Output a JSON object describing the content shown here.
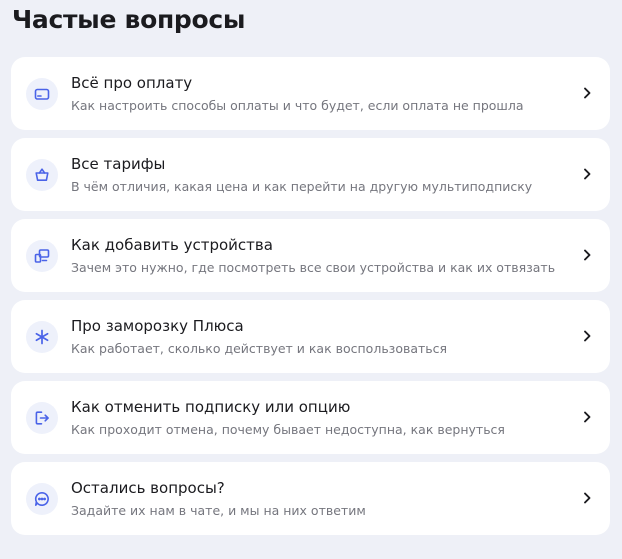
{
  "page": {
    "title": "Частые вопросы"
  },
  "colors": {
    "background": "#eef0f7",
    "card": "#ffffff",
    "accent": "#4a63e8",
    "icon_bg": "#eef1fb",
    "title_text": "#1b1b1f",
    "subtitle_text": "#75767e"
  },
  "faq": {
    "items": [
      {
        "icon": "credit-card-icon",
        "title": "Всё про оплату",
        "subtitle": "Как настроить способы оплаты и что будет, если оплата не прошла"
      },
      {
        "icon": "shopping-bag-icon",
        "title": "Все тарифы",
        "subtitle": "В чём отличия, какая цена и как перейти на другую мультиподписку"
      },
      {
        "icon": "devices-icon",
        "title": "Как добавить устройства",
        "subtitle": "Зачем это нужно, где посмотреть все свои устройства и как их отвязать"
      },
      {
        "icon": "snowflake-icon",
        "title": "Про заморозку Плюса",
        "subtitle": "Как работает, сколько действует и как воспользоваться"
      },
      {
        "icon": "exit-icon",
        "title": "Как отменить подписку или опцию",
        "subtitle": "Как проходит отмена, почему бывает недоступна, как вернуться"
      },
      {
        "icon": "chat-icon",
        "title": "Остались вопросы?",
        "subtitle": "Задайте их нам в чате, и мы на них ответим"
      }
    ]
  }
}
